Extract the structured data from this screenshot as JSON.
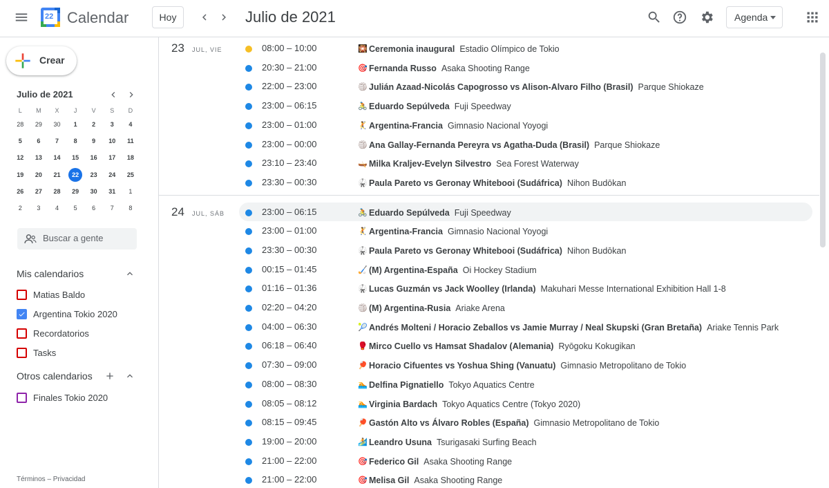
{
  "header": {
    "app_title": "Calendar",
    "logo_day": "22",
    "today_label": "Hoy",
    "month_title": "Julio de 2021",
    "view_label": "Agenda"
  },
  "sidebar": {
    "create_label": "Crear",
    "mini_month": "Julio de 2021",
    "weekdays": [
      "L",
      "M",
      "X",
      "J",
      "V",
      "S",
      "D"
    ],
    "weeks": [
      [
        "28",
        "29",
        "30",
        "1",
        "2",
        "3",
        "4"
      ],
      [
        "5",
        "6",
        "7",
        "8",
        "9",
        "10",
        "11"
      ],
      [
        "12",
        "13",
        "14",
        "15",
        "16",
        "17",
        "18"
      ],
      [
        "19",
        "20",
        "21",
        "22",
        "23",
        "24",
        "25"
      ],
      [
        "26",
        "27",
        "28",
        "29",
        "30",
        "31",
        "1"
      ],
      [
        "2",
        "3",
        "4",
        "5",
        "6",
        "7",
        "8"
      ]
    ],
    "people_placeholder": "Buscar a gente",
    "my_calendars_title": "Mis calendarios",
    "my_calendars": [
      {
        "name": "Matias Baldo",
        "color": "#d50000",
        "checked": false
      },
      {
        "name": "Argentina Tokio 2020",
        "color": "#4285f4",
        "checked": true
      },
      {
        "name": "Recordatorios",
        "color": "#d50000",
        "checked": false
      },
      {
        "name": "Tasks",
        "color": "#d50000",
        "checked": false
      }
    ],
    "other_calendars_title": "Otros calendarios",
    "other_calendars": [
      {
        "name": "Finales Tokio 2020",
        "color": "#8e24aa",
        "checked": false
      }
    ],
    "footer": "Términos – Privacidad"
  },
  "agenda": [
    {
      "day": "23",
      "label": "JUL, VIE",
      "events": [
        {
          "time": "08:00 – 10:00",
          "emoji": "🎇",
          "title": "Ceremonia inaugural",
          "location": "Estadio Olímpico de Tokio",
          "color": "#f6bf26"
        },
        {
          "time": "20:30 – 21:00",
          "emoji": "🎯",
          "title": "Fernanda Russo",
          "location": "Asaka Shooting Range",
          "color": "#1e88e5"
        },
        {
          "time": "22:00 – 23:00",
          "emoji": "🏐",
          "title": "Julián Azaad-Nicolás Capogrosso vs Alison-Alvaro Filho (Brasil)",
          "location": "Parque Shiokaze",
          "color": "#1e88e5"
        },
        {
          "time": "23:00 – 06:15",
          "emoji": "🚴",
          "title": "Eduardo Sepúlveda",
          "location": "Fuji Speedway",
          "color": "#1e88e5"
        },
        {
          "time": "23:00 – 01:00",
          "emoji": "🤾",
          "title": "Argentina-Francia",
          "location": "Gimnasio Nacional Yoyogi",
          "color": "#1e88e5"
        },
        {
          "time": "23:00 – 00:00",
          "emoji": "🏐",
          "title": "Ana Gallay-Fernanda Pereyra vs Agatha-Duda (Brasil)",
          "location": "Parque Shiokaze",
          "color": "#1e88e5"
        },
        {
          "time": "23:10 – 23:40",
          "emoji": "🛶",
          "title": "Milka Kraljev-Evelyn Silvestro",
          "location": "Sea Forest Waterway",
          "color": "#1e88e5"
        },
        {
          "time": "23:30 – 00:30",
          "emoji": "🥋",
          "title": "Paula Pareto vs Geronay Whitebooi (Sudáfrica)",
          "location": "Nihon Budōkan",
          "color": "#1e88e5"
        }
      ]
    },
    {
      "day": "24",
      "label": "JUL, SÁB",
      "events": [
        {
          "time": "23:00 – 06:15",
          "emoji": "🚴",
          "title": "Eduardo Sepúlveda",
          "location": "Fuji Speedway",
          "color": "#1e88e5"
        },
        {
          "time": "23:00 – 01:00",
          "emoji": "🤾",
          "title": "Argentina-Francia",
          "location": "Gimnasio Nacional Yoyogi",
          "color": "#1e88e5"
        },
        {
          "time": "23:30 – 00:30",
          "emoji": "🥋",
          "title": "Paula Pareto vs Geronay Whitebooi (Sudáfrica)",
          "location": "Nihon Budōkan",
          "color": "#1e88e5"
        },
        {
          "time": "00:15 – 01:45",
          "emoji": "🏑",
          "title": "(M) Argentina-España",
          "location": "Oi Hockey Stadium",
          "color": "#1e88e5"
        },
        {
          "time": "01:16 – 01:36",
          "emoji": "🥋",
          "title": "Lucas Guzmán vs Jack Woolley (Irlanda)",
          "location": "Makuhari Messe International Exhibition Hall 1-8",
          "color": "#1e88e5"
        },
        {
          "time": "02:20 – 04:20",
          "emoji": "🏐",
          "title": "(M) Argentina-Rusia",
          "location": "Ariake Arena",
          "color": "#1e88e5"
        },
        {
          "time": "04:00 – 06:30",
          "emoji": "🎾",
          "title": "Andrés Molteni / Horacio Zeballos vs Jamie Murray / Neal Skupski (Gran Bretaña)",
          "location": "Ariake Tennis Park",
          "color": "#1e88e5"
        },
        {
          "time": "06:18 – 06:40",
          "emoji": "🥊",
          "title": "Mirco Cuello vs Hamsat Shadalov (Alemania)",
          "location": "Ryōgoku Kokugikan",
          "color": "#1e88e5"
        },
        {
          "time": "07:30 – 09:00",
          "emoji": "🏓",
          "title": "Horacio Cifuentes vs Yoshua Shing (Vanuatu)",
          "location": "Gimnasio Metropolitano de Tokio",
          "color": "#1e88e5"
        },
        {
          "time": "08:00 – 08:30",
          "emoji": "🏊",
          "title": "Delfina Pignatiello",
          "location": "Tokyo Aquatics Centre",
          "color": "#1e88e5"
        },
        {
          "time": "08:05 – 08:12",
          "emoji": "🏊",
          "title": "Virginia Bardach",
          "location": "Tokyo Aquatics Centre (Tokyo 2020)",
          "color": "#1e88e5"
        },
        {
          "time": "08:15 – 09:45",
          "emoji": "🏓",
          "title": "Gastón Alto vs Álvaro Robles (España)",
          "location": "Gimnasio Metropolitano de Tokio",
          "color": "#1e88e5"
        },
        {
          "time": "19:00 – 20:00",
          "emoji": "🏄",
          "title": "Leandro Usuna",
          "location": "Tsurigasaki Surfing Beach",
          "color": "#1e88e5"
        },
        {
          "time": "21:00 – 22:00",
          "emoji": "🎯",
          "title": "Federico Gil",
          "location": "Asaka Shooting Range",
          "color": "#1e88e5"
        },
        {
          "time": "21:00 – 22:00",
          "emoji": "🎯",
          "title": "Melisa Gil",
          "location": "Asaka Shooting Range",
          "color": "#1e88e5"
        }
      ]
    }
  ],
  "colors": {
    "accent": "#1a73e8",
    "event_blue": "#1e88e5",
    "event_yellow": "#f6bf26"
  }
}
